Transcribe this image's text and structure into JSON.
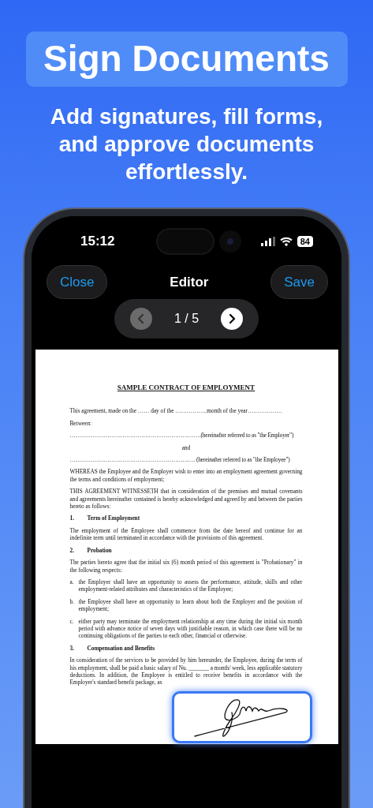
{
  "header": {
    "title": "Sign Documents",
    "subtitle": "Add signatures, fill forms, and approve documents effortlessly."
  },
  "status_bar": {
    "time": "15:12",
    "battery": "84"
  },
  "nav": {
    "close": "Close",
    "title": "Editor",
    "save": "Save"
  },
  "pager": {
    "label": "1 / 5",
    "prev_disabled": true,
    "next_disabled": false
  },
  "document": {
    "title": "SAMPLE CONTRACT OF EMPLOYMENT",
    "blocks": [
      {
        "kind": "para",
        "text": "This agreement, made on the …… day of the ……………..month of the year………………"
      },
      {
        "kind": "para",
        "text": "Between:"
      },
      {
        "kind": "fill",
        "text": "…………………………………………………………….(hereinafter referred to as \"the Employer\")"
      },
      {
        "kind": "center",
        "text": "and"
      },
      {
        "kind": "fill",
        "text": "…………………………………………………………. (hereinafter referred to as \"the Employee\")"
      },
      {
        "kind": "para",
        "text": "WHEREAS the Employee and the Employer wish to enter into an employment agreement governing the terms and conditions of employment;"
      },
      {
        "kind": "para",
        "text": "THIS AGREEMENT WITNESSETH that in consideration of the premises and mutual covenants and agreements hereinafter contained is hereby acknowledged and agreed by and between the parties hereto as follows:"
      },
      {
        "kind": "heading",
        "marker": "1.",
        "text": "Term of Employment"
      },
      {
        "kind": "para",
        "text": "The employment of the Employee shall commence from the date hereof and continue for an indefinite term until terminated in accordance with the provisions of this agreement."
      },
      {
        "kind": "heading",
        "marker": "2.",
        "text": "Probation"
      },
      {
        "kind": "para",
        "text": "The parties hereto agree that the initial six (6) month period of this agreement is \"Probationary\" in the following respects:"
      },
      {
        "kind": "item",
        "marker": "a.",
        "text": "the Employer shall have an opportunity to assess the performance, attitude, skills and other employment-related attributes and characteristics of the Employee;"
      },
      {
        "kind": "item",
        "marker": "b.",
        "text": "the Employee shall have an opportunity to learn about both the Employer and the position of employment;"
      },
      {
        "kind": "item",
        "marker": "c.",
        "text": "either party may terminate the employment relationship at any time during the initial six month period with advance notice of seven days with justifiable reason, in which case there will be no continuing obligations of the parties to each other, financial or otherwise."
      },
      {
        "kind": "heading",
        "marker": "3.",
        "text": "Compensation and Benefits"
      },
      {
        "kind": "para",
        "text": "In consideration of the services to be provided by him hereunder, the Employee, during the term of his employment, shall be paid a basic salary of Nu. _______ a month/ week, less applicable statutory deductions. In addition, the Employee is entitled to receive benefits in accordance with the Employer's standard benefit package, as"
      }
    ]
  }
}
